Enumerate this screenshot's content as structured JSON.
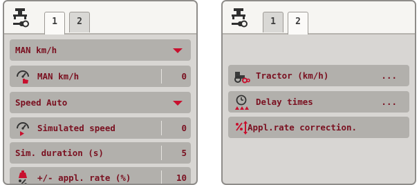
{
  "left_screen": {
    "tabs": [
      "1",
      "2"
    ],
    "rows": [
      {
        "label": "MAN km/h",
        "kind": "dropdown"
      },
      {
        "label": "MAN km/h",
        "icon": "hand-speedometer-icon",
        "value": "0"
      },
      {
        "label": "Speed Auto",
        "kind": "dropdown"
      },
      {
        "label": "Simulated speed",
        "icon": "speedometer-play-icon",
        "value": "0"
      },
      {
        "label": "Sim. duration (s)",
        "value": "5"
      },
      {
        "label": "+/- appl. rate (%)",
        "icon": "weight-percent-icon",
        "value": "10"
      }
    ]
  },
  "right_screen": {
    "tabs": [
      "1",
      "2"
    ],
    "rows": [
      {
        "label": "Tractor (km/h)",
        "icon": "tractor-icon",
        "value": "..."
      },
      {
        "label": "Delay times",
        "icon": "clock-triangles-icon",
        "value": "..."
      },
      {
        "label": "Appl.rate correction.",
        "icon": "rate-correction-icon"
      }
    ]
  },
  "colors": {
    "label_text": "#7a1020",
    "accent_red": "#c8102e",
    "row_background": "#b2b0ac",
    "panel_background": "#d8d6d3"
  }
}
